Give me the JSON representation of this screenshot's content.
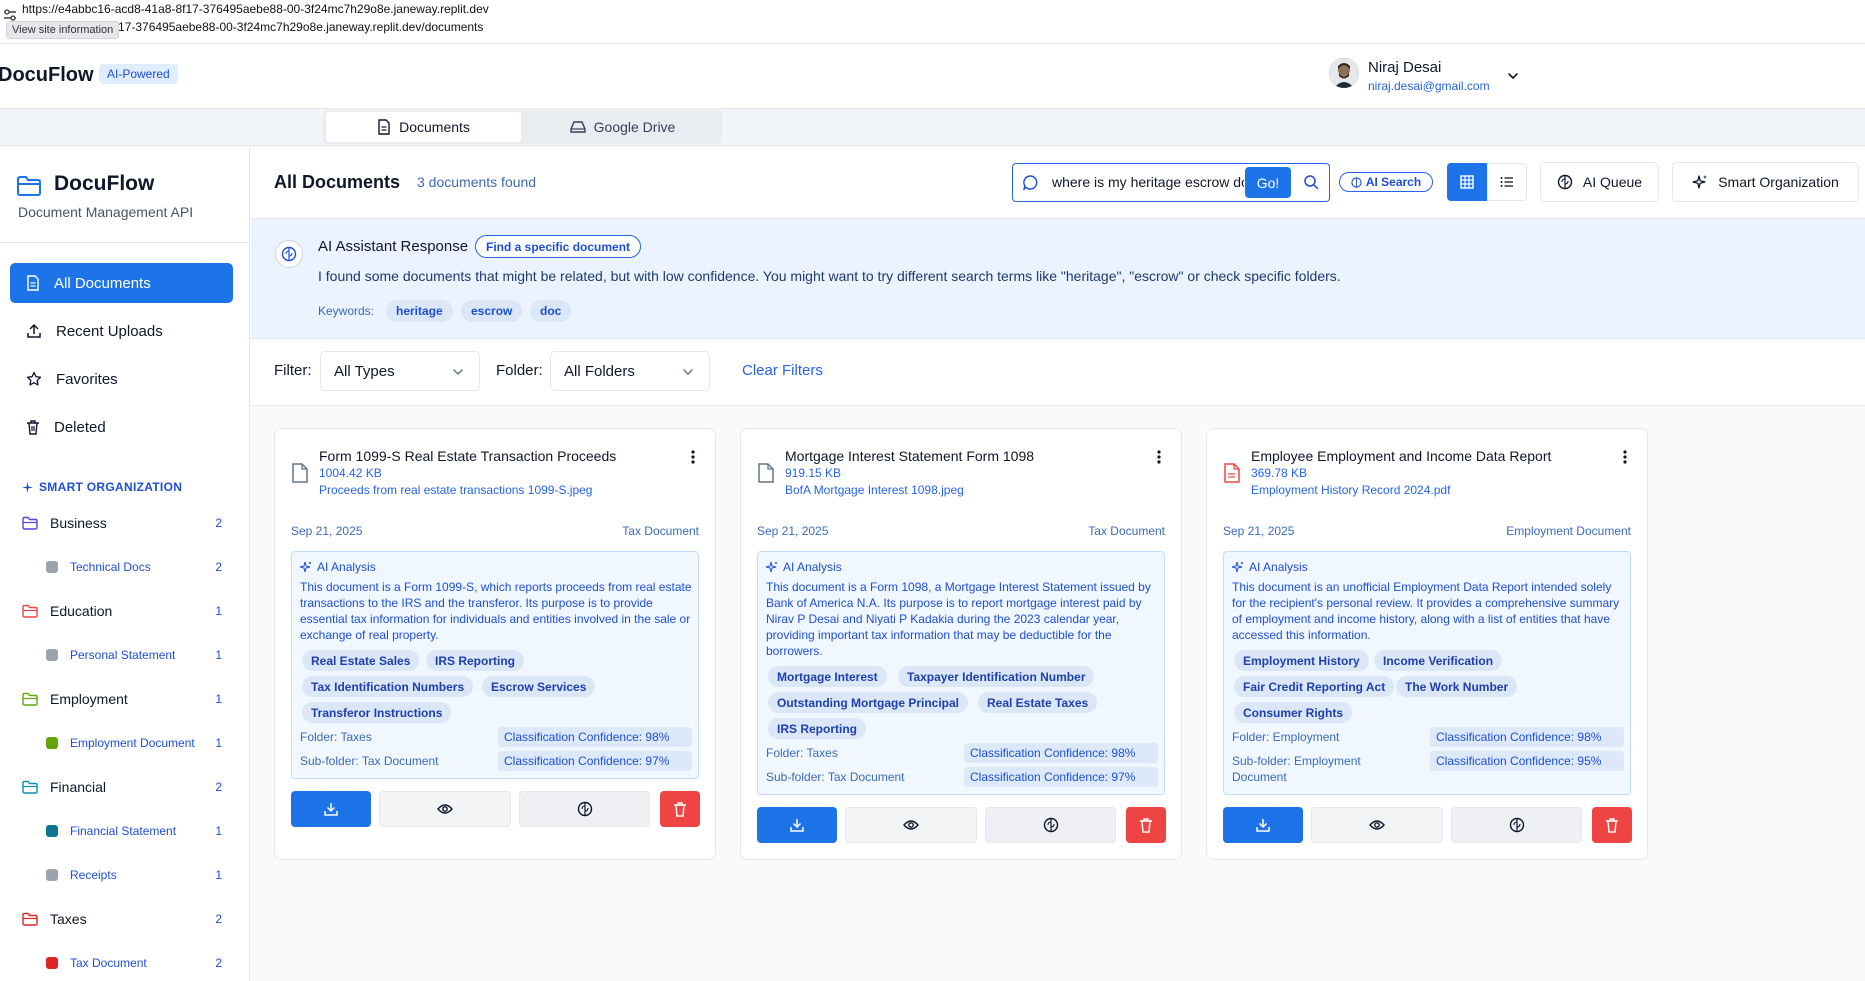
{
  "browser": {
    "url": "https://e4abbc16-acd8-41a8-8f17-376495aebe88-00-3f24mc7h29o8e.janeway.replit.dev",
    "url_line2": "1a8-8f17-376495aebe88-00-3f24mc7h29o8e.janeway.replit.dev/documents",
    "tooltip": "View site information"
  },
  "header": {
    "brand": "DocuFlow",
    "badge": "AI-Powered",
    "user_name": "Niraj Desai",
    "user_email": "niraj.desai@gmail.com"
  },
  "tabs": [
    {
      "label": "Documents",
      "icon": "document-icon",
      "active": true
    },
    {
      "label": "Google Drive",
      "icon": "drive-icon",
      "active": false
    }
  ],
  "sidebar": {
    "title": "DocuFlow",
    "subtitle": "Document Management API",
    "nav": [
      {
        "label": "All Documents",
        "icon": "file-icon",
        "active": true
      },
      {
        "label": "Recent Uploads",
        "icon": "upload-icon"
      },
      {
        "label": "Favorites",
        "icon": "star-icon"
      },
      {
        "label": "Deleted",
        "icon": "trash-icon"
      }
    ],
    "smart_header": "SMART ORGANIZATION",
    "categories": [
      {
        "label": "Business",
        "count": "2",
        "color": "#4f46e5",
        "subs": [
          {
            "label": "Technical Docs",
            "count": "2",
            "color": "#9ca3af"
          }
        ]
      },
      {
        "label": "Education",
        "count": "1",
        "color": "#ef4444",
        "subs": [
          {
            "label": "Personal Statement",
            "count": "1",
            "color": "#9ca3af"
          }
        ]
      },
      {
        "label": "Employment",
        "count": "1",
        "color": "#65a30d",
        "subs": [
          {
            "label": "Employment Document",
            "count": "1",
            "color": "#65a30d"
          }
        ]
      },
      {
        "label": "Financial",
        "count": "2",
        "color": "#0891b2",
        "subs": [
          {
            "label": "Financial Statement",
            "count": "1",
            "color": "#0e7490"
          },
          {
            "label": "Receipts",
            "count": "1",
            "color": "#9ca3af"
          }
        ]
      },
      {
        "label": "Taxes",
        "count": "2",
        "color": "#dc2626",
        "subs": [
          {
            "label": "Tax Document",
            "count": "2",
            "color": "#dc2626"
          }
        ]
      }
    ]
  },
  "main": {
    "title": "All Documents",
    "count_text": "3 documents found",
    "search_value": "where is my heritage escrow doc",
    "go_label": "Go!",
    "ai_search_label": "AI Search",
    "ai_queue_label": "AI Queue",
    "smart_org_label": "Smart Organization"
  },
  "ai_response": {
    "title": "AI Assistant Response",
    "intent": "Find a specific document",
    "message": "I found some documents that might be related, but with low confidence. You might want to try different search terms like \"heritage\", \"escrow\" or check specific folders.",
    "keywords_label": "Keywords:",
    "keywords": [
      "heritage",
      "escrow",
      "doc"
    ]
  },
  "filters": {
    "filter_label": "Filter:",
    "filter_value": "All Types",
    "folder_label": "Folder:",
    "folder_value": "All Folders",
    "clear_label": "Clear Filters"
  },
  "cards": [
    {
      "title": "Form 1099-S Real Estate Transaction Proceeds",
      "size": "1004.42 KB",
      "filename": "Proceeds from real estate transactions 1099-S.jpeg",
      "date": "Sep 21, 2025",
      "doc_type": "Tax Document",
      "file_icon_color": "#64748b",
      "ai_label": "AI Analysis",
      "summary": "This document is a Form 1099-S, which reports proceeds from real estate transactions to the IRS and the transferor. Its purpose is to provide essential tax information for individuals and entities involved in the sale or exchange of real property.",
      "tags": [
        "Real Estate Sales",
        "IRS Reporting",
        "Tax Identification Numbers",
        "Escrow Services",
        "Transferor Instructions"
      ],
      "folder": "Folder: Taxes",
      "folder_conf": "Classification Confidence: 98%",
      "subfolder": "Sub-folder: Tax Document",
      "subfolder_conf": "Classification Confidence: 97%"
    },
    {
      "title": "Mortgage Interest Statement Form 1098",
      "size": "919.15 KB",
      "filename": "BofA Mortgage Interest 1098.jpeg",
      "date": "Sep 21, 2025",
      "doc_type": "Tax Document",
      "file_icon_color": "#64748b",
      "ai_label": "AI Analysis",
      "summary": "This document is a Form 1098, a Mortgage Interest Statement issued by Bank of America N.A. Its purpose is to report mortgage interest paid by Nirav P Desai and Niyati P Kadakia during the 2023 calendar year, providing important tax information that may be deductible for the borrowers.",
      "tags": [
        "Mortgage Interest",
        "Taxpayer Identification Number",
        "Outstanding Mortgage Principal",
        "Real Estate Taxes",
        "IRS Reporting"
      ],
      "folder": "Folder: Taxes",
      "folder_conf": "Classification Confidence: 98%",
      "subfolder": "Sub-folder: Tax Document",
      "subfolder_conf": "Classification Confidence: 97%"
    },
    {
      "title": "Employee Employment and Income Data Report",
      "size": "369.78 KB",
      "filename": "Employment History Record 2024.pdf",
      "date": "Sep 21, 2025",
      "doc_type": "Employment Document",
      "file_icon_color": "#ef4444",
      "ai_label": "AI Analysis",
      "summary": "This document is an unofficial Employment Data Report intended solely for the recipient's personal review. It provides a comprehensive summary of employment and income history, along with a list of entities that have accessed this information.",
      "tags": [
        "Employment History",
        "Income Verification",
        "Fair Credit Reporting Act",
        "The Work Number",
        "Consumer Rights"
      ],
      "folder": "Folder: Employment",
      "folder_conf": "Classification Confidence: 98%",
      "subfolder": "Sub-folder: Employment Document",
      "subfolder_conf": "Classification Confidence: 95%"
    }
  ]
}
